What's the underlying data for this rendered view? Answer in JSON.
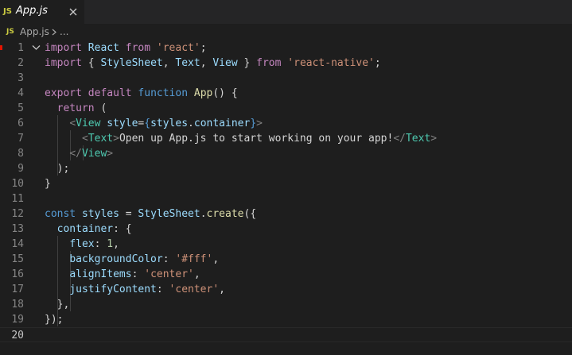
{
  "tab": {
    "icon_label": "JS",
    "title": "App.js",
    "close_icon": "close-icon"
  },
  "breadcrumb": {
    "icon_label": "JS",
    "file": "App.js",
    "separator_icon": "chevron-right-icon",
    "symbol": "..."
  },
  "colors": {
    "keyword": "#c586c0",
    "storage": "#569cd6",
    "function": "#dcdcaa",
    "variable": "#9cdcfe",
    "string": "#ce9178",
    "number": "#b5cea8",
    "tag": "#4ec9b0",
    "line_number": "#858585",
    "background": "#1e1e1e"
  },
  "editor": {
    "current_line": 20,
    "lines": [
      {
        "n": "1",
        "tokens": [
          [
            "kw",
            "import"
          ],
          [
            "pl",
            " "
          ],
          [
            "vr",
            "React"
          ],
          [
            "pl",
            " "
          ],
          [
            "kw",
            "from"
          ],
          [
            "pl",
            " "
          ],
          [
            "str",
            "'react'"
          ],
          [
            "pl",
            ";"
          ]
        ]
      },
      {
        "n": "2",
        "tokens": [
          [
            "kw",
            "import"
          ],
          [
            "pl",
            " { "
          ],
          [
            "vr",
            "StyleSheet"
          ],
          [
            "pl",
            ", "
          ],
          [
            "vr",
            "Text"
          ],
          [
            "pl",
            ", "
          ],
          [
            "vr",
            "View"
          ],
          [
            "pl",
            " } "
          ],
          [
            "kw",
            "from"
          ],
          [
            "pl",
            " "
          ],
          [
            "str",
            "'react-native'"
          ],
          [
            "pl",
            ";"
          ]
        ]
      },
      {
        "n": "3",
        "tokens": []
      },
      {
        "n": "4",
        "tokens": [
          [
            "kw",
            "export"
          ],
          [
            "pl",
            " "
          ],
          [
            "kw",
            "default"
          ],
          [
            "pl",
            " "
          ],
          [
            "st",
            "function"
          ],
          [
            "pl",
            " "
          ],
          [
            "fn",
            "App"
          ],
          [
            "pl",
            "() {"
          ]
        ]
      },
      {
        "n": "5",
        "tokens": [
          [
            "pl",
            "  "
          ],
          [
            "kw",
            "return"
          ],
          [
            "pl",
            " ("
          ]
        ]
      },
      {
        "n": "6",
        "tokens": [
          [
            "pl",
            "    "
          ],
          [
            "br",
            "<"
          ],
          [
            "tag",
            "View"
          ],
          [
            "pl",
            " "
          ],
          [
            "vr",
            "style"
          ],
          [
            "pl",
            "="
          ],
          [
            "st",
            "{"
          ],
          [
            "vr",
            "styles"
          ],
          [
            "pl",
            "."
          ],
          [
            "vr",
            "container"
          ],
          [
            "st",
            "}"
          ],
          [
            "br",
            ">"
          ]
        ]
      },
      {
        "n": "7",
        "tokens": [
          [
            "pl",
            "      "
          ],
          [
            "br",
            "<"
          ],
          [
            "tag",
            "Text"
          ],
          [
            "br",
            ">"
          ],
          [
            "pl",
            "Open up App.js to start working on your app!"
          ],
          [
            "br",
            "</"
          ],
          [
            "tag",
            "Text"
          ],
          [
            "br",
            ">"
          ]
        ]
      },
      {
        "n": "8",
        "tokens": [
          [
            "pl",
            "    "
          ],
          [
            "br",
            "</"
          ],
          [
            "tag",
            "View"
          ],
          [
            "br",
            ">"
          ]
        ]
      },
      {
        "n": "9",
        "tokens": [
          [
            "pl",
            "  );"
          ]
        ]
      },
      {
        "n": "10",
        "tokens": [
          [
            "pl",
            "}"
          ]
        ]
      },
      {
        "n": "11",
        "tokens": []
      },
      {
        "n": "12",
        "tokens": [
          [
            "st",
            "const"
          ],
          [
            "pl",
            " "
          ],
          [
            "vr",
            "styles"
          ],
          [
            "pl",
            " = "
          ],
          [
            "vr",
            "StyleSheet"
          ],
          [
            "pl",
            "."
          ],
          [
            "fn",
            "create"
          ],
          [
            "pl",
            "({"
          ]
        ]
      },
      {
        "n": "13",
        "tokens": [
          [
            "pl",
            "  "
          ],
          [
            "vr",
            "container"
          ],
          [
            "pl",
            ": {"
          ]
        ]
      },
      {
        "n": "14",
        "tokens": [
          [
            "pl",
            "    "
          ],
          [
            "vr",
            "flex"
          ],
          [
            "pl",
            ": "
          ],
          [
            "num",
            "1"
          ],
          [
            "pl",
            ","
          ]
        ]
      },
      {
        "n": "15",
        "tokens": [
          [
            "pl",
            "    "
          ],
          [
            "vr",
            "backgroundColor"
          ],
          [
            "pl",
            ": "
          ],
          [
            "str",
            "'#fff'"
          ],
          [
            "pl",
            ","
          ]
        ]
      },
      {
        "n": "16",
        "tokens": [
          [
            "pl",
            "    "
          ],
          [
            "vr",
            "alignItems"
          ],
          [
            "pl",
            ": "
          ],
          [
            "str",
            "'center'"
          ],
          [
            "pl",
            ","
          ]
        ]
      },
      {
        "n": "17",
        "tokens": [
          [
            "pl",
            "    "
          ],
          [
            "vr",
            "justifyContent"
          ],
          [
            "pl",
            ": "
          ],
          [
            "str",
            "'center'"
          ],
          [
            "pl",
            ","
          ]
        ]
      },
      {
        "n": "18",
        "tokens": [
          [
            "pl",
            "  },"
          ]
        ]
      },
      {
        "n": "19",
        "tokens": [
          [
            "pl",
            "});"
          ]
        ]
      },
      {
        "n": "20",
        "tokens": []
      }
    ]
  }
}
